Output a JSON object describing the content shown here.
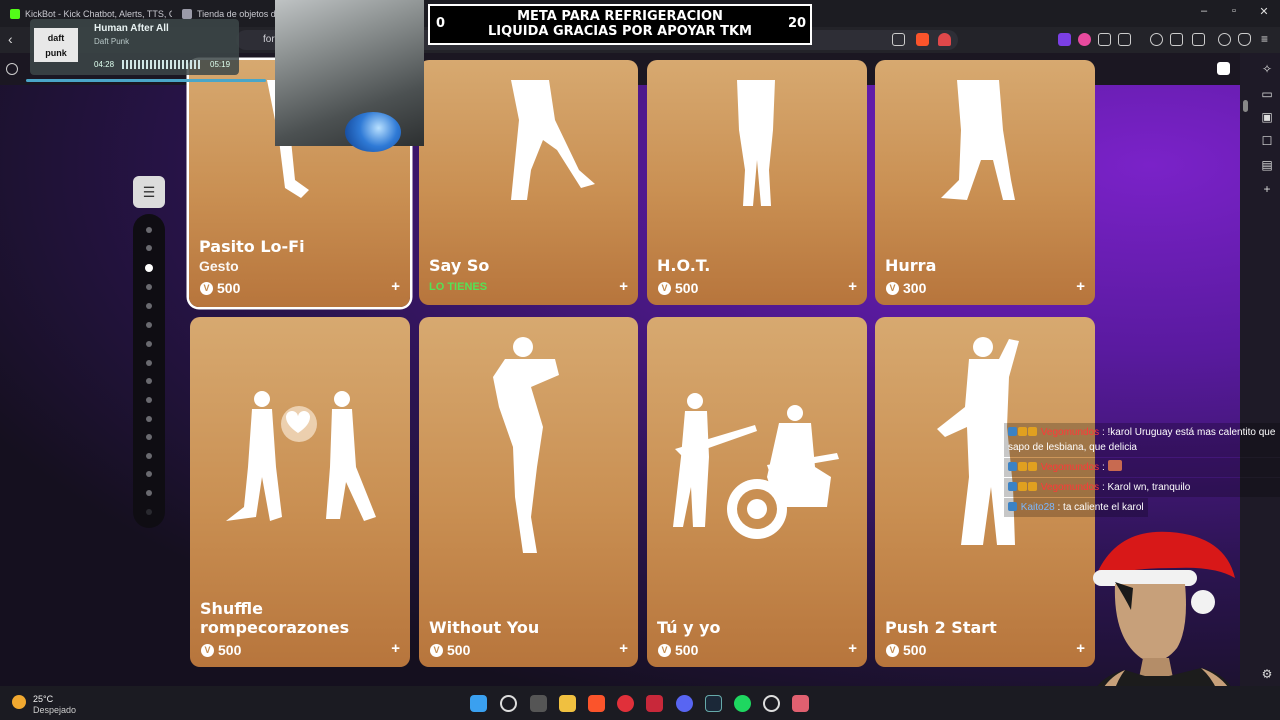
{
  "browser": {
    "tabs": [
      {
        "title": "KickBot - Kick Chatbot, Alerts, TTS, Ch"
      },
      {
        "title": "Tienda de objetos de"
      }
    ],
    "url_fragment": "for"
  },
  "music": {
    "song": "Human After All",
    "artist": "Daft Punk",
    "elapsed": "04:28",
    "duration": "05:19",
    "album_line1": "daft",
    "album_line2": "punk"
  },
  "goal": {
    "title_line1": "META PARA REFRIGERACION",
    "title_line2": "LIQUIDA GRACIAS POR APOYAR TKM",
    "current": "0",
    "target": "20"
  },
  "shop": {
    "row1": [
      {
        "name": "Pasito Lo-Fi",
        "type": "Gesto",
        "price": "500",
        "owned": false
      },
      {
        "name": "Say So",
        "owned_label": "LO TIENES",
        "owned": true
      },
      {
        "name": "H.O.T.",
        "price": "500",
        "owned": false
      },
      {
        "name": "Hurra",
        "price": "300",
        "owned": false
      }
    ],
    "row2": [
      {
        "name_line1": "Shuffle",
        "name_line2": "rompecorazones",
        "price": "500"
      },
      {
        "name": "Without You",
        "price": "500"
      },
      {
        "name": "Tú y yo",
        "price": "500"
      },
      {
        "name": "Push 2 Start",
        "price": "500"
      }
    ],
    "vbucks_symbol": "V",
    "add_symbol": "+"
  },
  "chat": [
    {
      "user": "Vegomundos",
      "text": "!karol Uruguay está mas calentito que sapo de lesbiana, que delicia"
    },
    {
      "user": "Vegomundos",
      "text": ""
    },
    {
      "user": "Vegomundos",
      "text": "Karol wn, tranquilo"
    },
    {
      "user": "Kaito28",
      "text": "ta caliente el karol"
    }
  ],
  "weather": {
    "temp": "25°C",
    "condition": "Despejado"
  },
  "colors": {
    "card_top": "#d7a970",
    "card_bottom": "#b7753c",
    "owned_green": "#55e255",
    "accent_purple": "#7a22c8"
  }
}
